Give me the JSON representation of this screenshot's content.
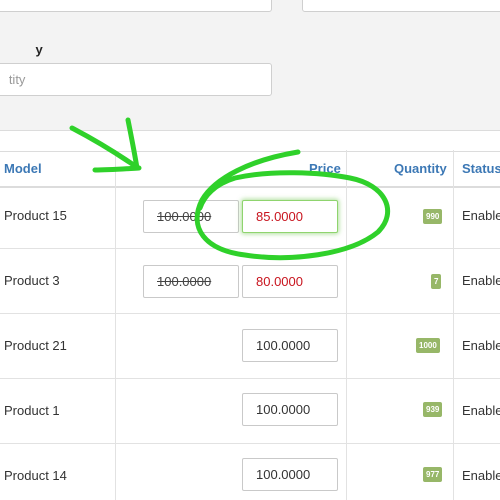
{
  "filters": {
    "quantity_label": "y",
    "quantity_placeholder": "tity"
  },
  "table": {
    "headers": {
      "model": "Model",
      "price": "Price",
      "quantity": "Quantity",
      "status": "Status"
    },
    "rows": [
      {
        "model": "Product 15",
        "old_price": "100.0000",
        "special_price": "85.0000",
        "price": "",
        "quantity": "990",
        "status": "Enabled"
      },
      {
        "model": "Product 3",
        "old_price": "100.0000",
        "special_price": "80.0000",
        "price": "",
        "quantity": "7",
        "status": "Enabled"
      },
      {
        "model": "Product 21",
        "old_price": "",
        "special_price": "",
        "price": "100.0000",
        "quantity": "1000",
        "status": "Enabled"
      },
      {
        "model": "Product 1",
        "old_price": "",
        "special_price": "",
        "price": "100.0000",
        "quantity": "939",
        "status": "Enabled"
      },
      {
        "model": "Product 14",
        "old_price": "",
        "special_price": "",
        "price": "100.0000",
        "quantity": "977",
        "status": "Enabled"
      }
    ]
  },
  "colors": {
    "header_text": "#3c78b5",
    "special_price": "#c8141e",
    "quantity_badge": "#97b768",
    "annotation": "#2fd12a"
  },
  "icons": {
    "annotation_arrow": "hand-drawn-arrow-icon",
    "annotation_circle": "hand-drawn-circle-icon"
  }
}
